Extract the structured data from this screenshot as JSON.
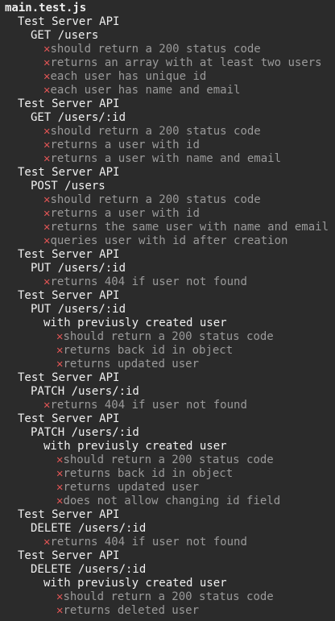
{
  "file_header": "main.test.js",
  "fail_mark": "✕",
  "lines": [
    {
      "depth": 1,
      "kind": "suite",
      "text": "Test Server API"
    },
    {
      "depth": 2,
      "kind": "suite",
      "text": "GET /users"
    },
    {
      "depth": 3,
      "kind": "test",
      "text": "should return a 200 status code"
    },
    {
      "depth": 3,
      "kind": "test",
      "text": "returns an array with at least two users"
    },
    {
      "depth": 3,
      "kind": "test",
      "text": "each user has unique id"
    },
    {
      "depth": 3,
      "kind": "test",
      "text": "each user has name and email"
    },
    {
      "depth": 1,
      "kind": "suite",
      "text": "Test Server API"
    },
    {
      "depth": 2,
      "kind": "suite",
      "text": "GET /users/:id"
    },
    {
      "depth": 3,
      "kind": "test",
      "text": "should return a 200 status code"
    },
    {
      "depth": 3,
      "kind": "test",
      "text": "returns a user with id"
    },
    {
      "depth": 3,
      "kind": "test",
      "text": "returns a user with name and email"
    },
    {
      "depth": 1,
      "kind": "suite",
      "text": "Test Server API"
    },
    {
      "depth": 2,
      "kind": "suite",
      "text": "POST /users"
    },
    {
      "depth": 3,
      "kind": "test",
      "text": "should return a 200 status code"
    },
    {
      "depth": 3,
      "kind": "test",
      "text": "returns a user with id"
    },
    {
      "depth": 3,
      "kind": "test",
      "text": "returns the same user with name and email"
    },
    {
      "depth": 3,
      "kind": "test",
      "text": "queries user with id after creation"
    },
    {
      "depth": 1,
      "kind": "suite",
      "text": "Test Server API"
    },
    {
      "depth": 2,
      "kind": "suite",
      "text": "PUT /users/:id"
    },
    {
      "depth": 3,
      "kind": "test",
      "text": "returns 404 if user not found"
    },
    {
      "depth": 1,
      "kind": "suite",
      "text": "Test Server API"
    },
    {
      "depth": 2,
      "kind": "suite",
      "text": "PUT /users/:id"
    },
    {
      "depth": 3,
      "kind": "suite",
      "text": "with previusly created user"
    },
    {
      "depth": 4,
      "kind": "test",
      "text": "should return a 200 status code"
    },
    {
      "depth": 4,
      "kind": "test",
      "text": "returns back id in object"
    },
    {
      "depth": 4,
      "kind": "test",
      "text": "returns updated user"
    },
    {
      "depth": 1,
      "kind": "suite",
      "text": "Test Server API"
    },
    {
      "depth": 2,
      "kind": "suite",
      "text": "PATCH /users/:id"
    },
    {
      "depth": 3,
      "kind": "test",
      "text": "returns 404 if user not found"
    },
    {
      "depth": 1,
      "kind": "suite",
      "text": "Test Server API"
    },
    {
      "depth": 2,
      "kind": "suite",
      "text": "PATCH /users/:id"
    },
    {
      "depth": 3,
      "kind": "suite",
      "text": "with previusly created user"
    },
    {
      "depth": 4,
      "kind": "test",
      "text": "should return a 200 status code"
    },
    {
      "depth": 4,
      "kind": "test",
      "text": "returns back id in object"
    },
    {
      "depth": 4,
      "kind": "test",
      "text": "returns updated user"
    },
    {
      "depth": 4,
      "kind": "test",
      "text": "does not allow changing id field"
    },
    {
      "depth": 1,
      "kind": "suite",
      "text": "Test Server API"
    },
    {
      "depth": 2,
      "kind": "suite",
      "text": "DELETE /users/:id"
    },
    {
      "depth": 3,
      "kind": "test",
      "text": "returns 404 if user not found"
    },
    {
      "depth": 1,
      "kind": "suite",
      "text": "Test Server API"
    },
    {
      "depth": 2,
      "kind": "suite",
      "text": "DELETE /users/:id"
    },
    {
      "depth": 3,
      "kind": "suite",
      "text": "with previusly created user"
    },
    {
      "depth": 4,
      "kind": "test",
      "text": "should return a 200 status code"
    },
    {
      "depth": 4,
      "kind": "test",
      "text": "returns deleted user"
    }
  ],
  "colors": {
    "background": "#2b2b2b",
    "file_header": "#eeeeee",
    "suite": "#f0f0f0",
    "test": "#9a9a9a",
    "fail_mark": "#e05555"
  }
}
